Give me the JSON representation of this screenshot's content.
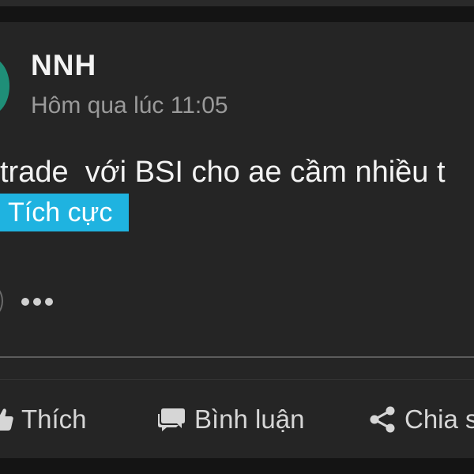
{
  "post": {
    "author_name": "NNH",
    "timestamp": "Hôm qua lúc 11:05",
    "text": "trade  với BSI cho ae cầm nhiều t",
    "sentiment_tag": "Tích cực"
  },
  "actions": {
    "like_label": "Thích",
    "comment_label": "Bình luận",
    "share_label": "Chia s"
  },
  "icons": {
    "avatar": "avatar",
    "more": "more-options-icon",
    "like": "thumbs-up-icon",
    "comment": "comment-bubble-icon",
    "share": "share-icon"
  },
  "colors": {
    "background": "#141414",
    "card": "#252525",
    "tag_background": "#1fb3e0",
    "avatar": "#1f8f78",
    "muted_text": "#9a9a9a"
  }
}
